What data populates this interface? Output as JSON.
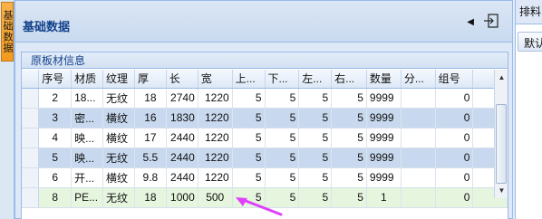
{
  "side_tab": {
    "label": "基础数据"
  },
  "panel": {
    "title": "基础数据"
  },
  "group": {
    "title": "原板材信息"
  },
  "columns": [
    "序号",
    "材质",
    "纹理",
    "厚",
    "长",
    "宽",
    "上...",
    "下...",
    "左...",
    "右...",
    "数量",
    "分...",
    "组号"
  ],
  "rows": [
    [
      "2",
      "18...",
      "无纹",
      "18",
      "2740",
      "1220",
      "5",
      "5",
      "5",
      "5",
      "9999",
      "",
      "0"
    ],
    [
      "3",
      "密...",
      "横纹",
      "16",
      "1830",
      "1220",
      "5",
      "5",
      "5",
      "5",
      "9999",
      "",
      "0"
    ],
    [
      "4",
      "映...",
      "横纹",
      "17",
      "2440",
      "1220",
      "5",
      "5",
      "5",
      "5",
      "9999",
      "",
      "0"
    ],
    [
      "5",
      "映...",
      "无纹",
      "5.5",
      "2440",
      "1220",
      "5",
      "5",
      "5",
      "5",
      "9999",
      "",
      "0"
    ],
    [
      "6",
      "开...",
      "横纹",
      "9.8",
      "2440",
      "1220",
      "5",
      "5",
      "5",
      "5",
      "9999",
      "",
      "0"
    ],
    [
      "8",
      "PE...",
      "无纹",
      "18",
      "1000",
      "500",
      "5",
      "5",
      "5",
      "5",
      "1",
      "",
      "0"
    ]
  ],
  "right_panel": {
    "tab_label": "排料",
    "button_label": "默认"
  },
  "colors": {
    "accent": "#15428b",
    "alt_row": "#c8d9ef",
    "selected_row": "#e6f6de",
    "annotation_arrow": "#e040fb"
  },
  "icons": {
    "collapse": "triangle-left-icon",
    "exit": "exit-door-icon",
    "annotation": "arrow-icon"
  }
}
